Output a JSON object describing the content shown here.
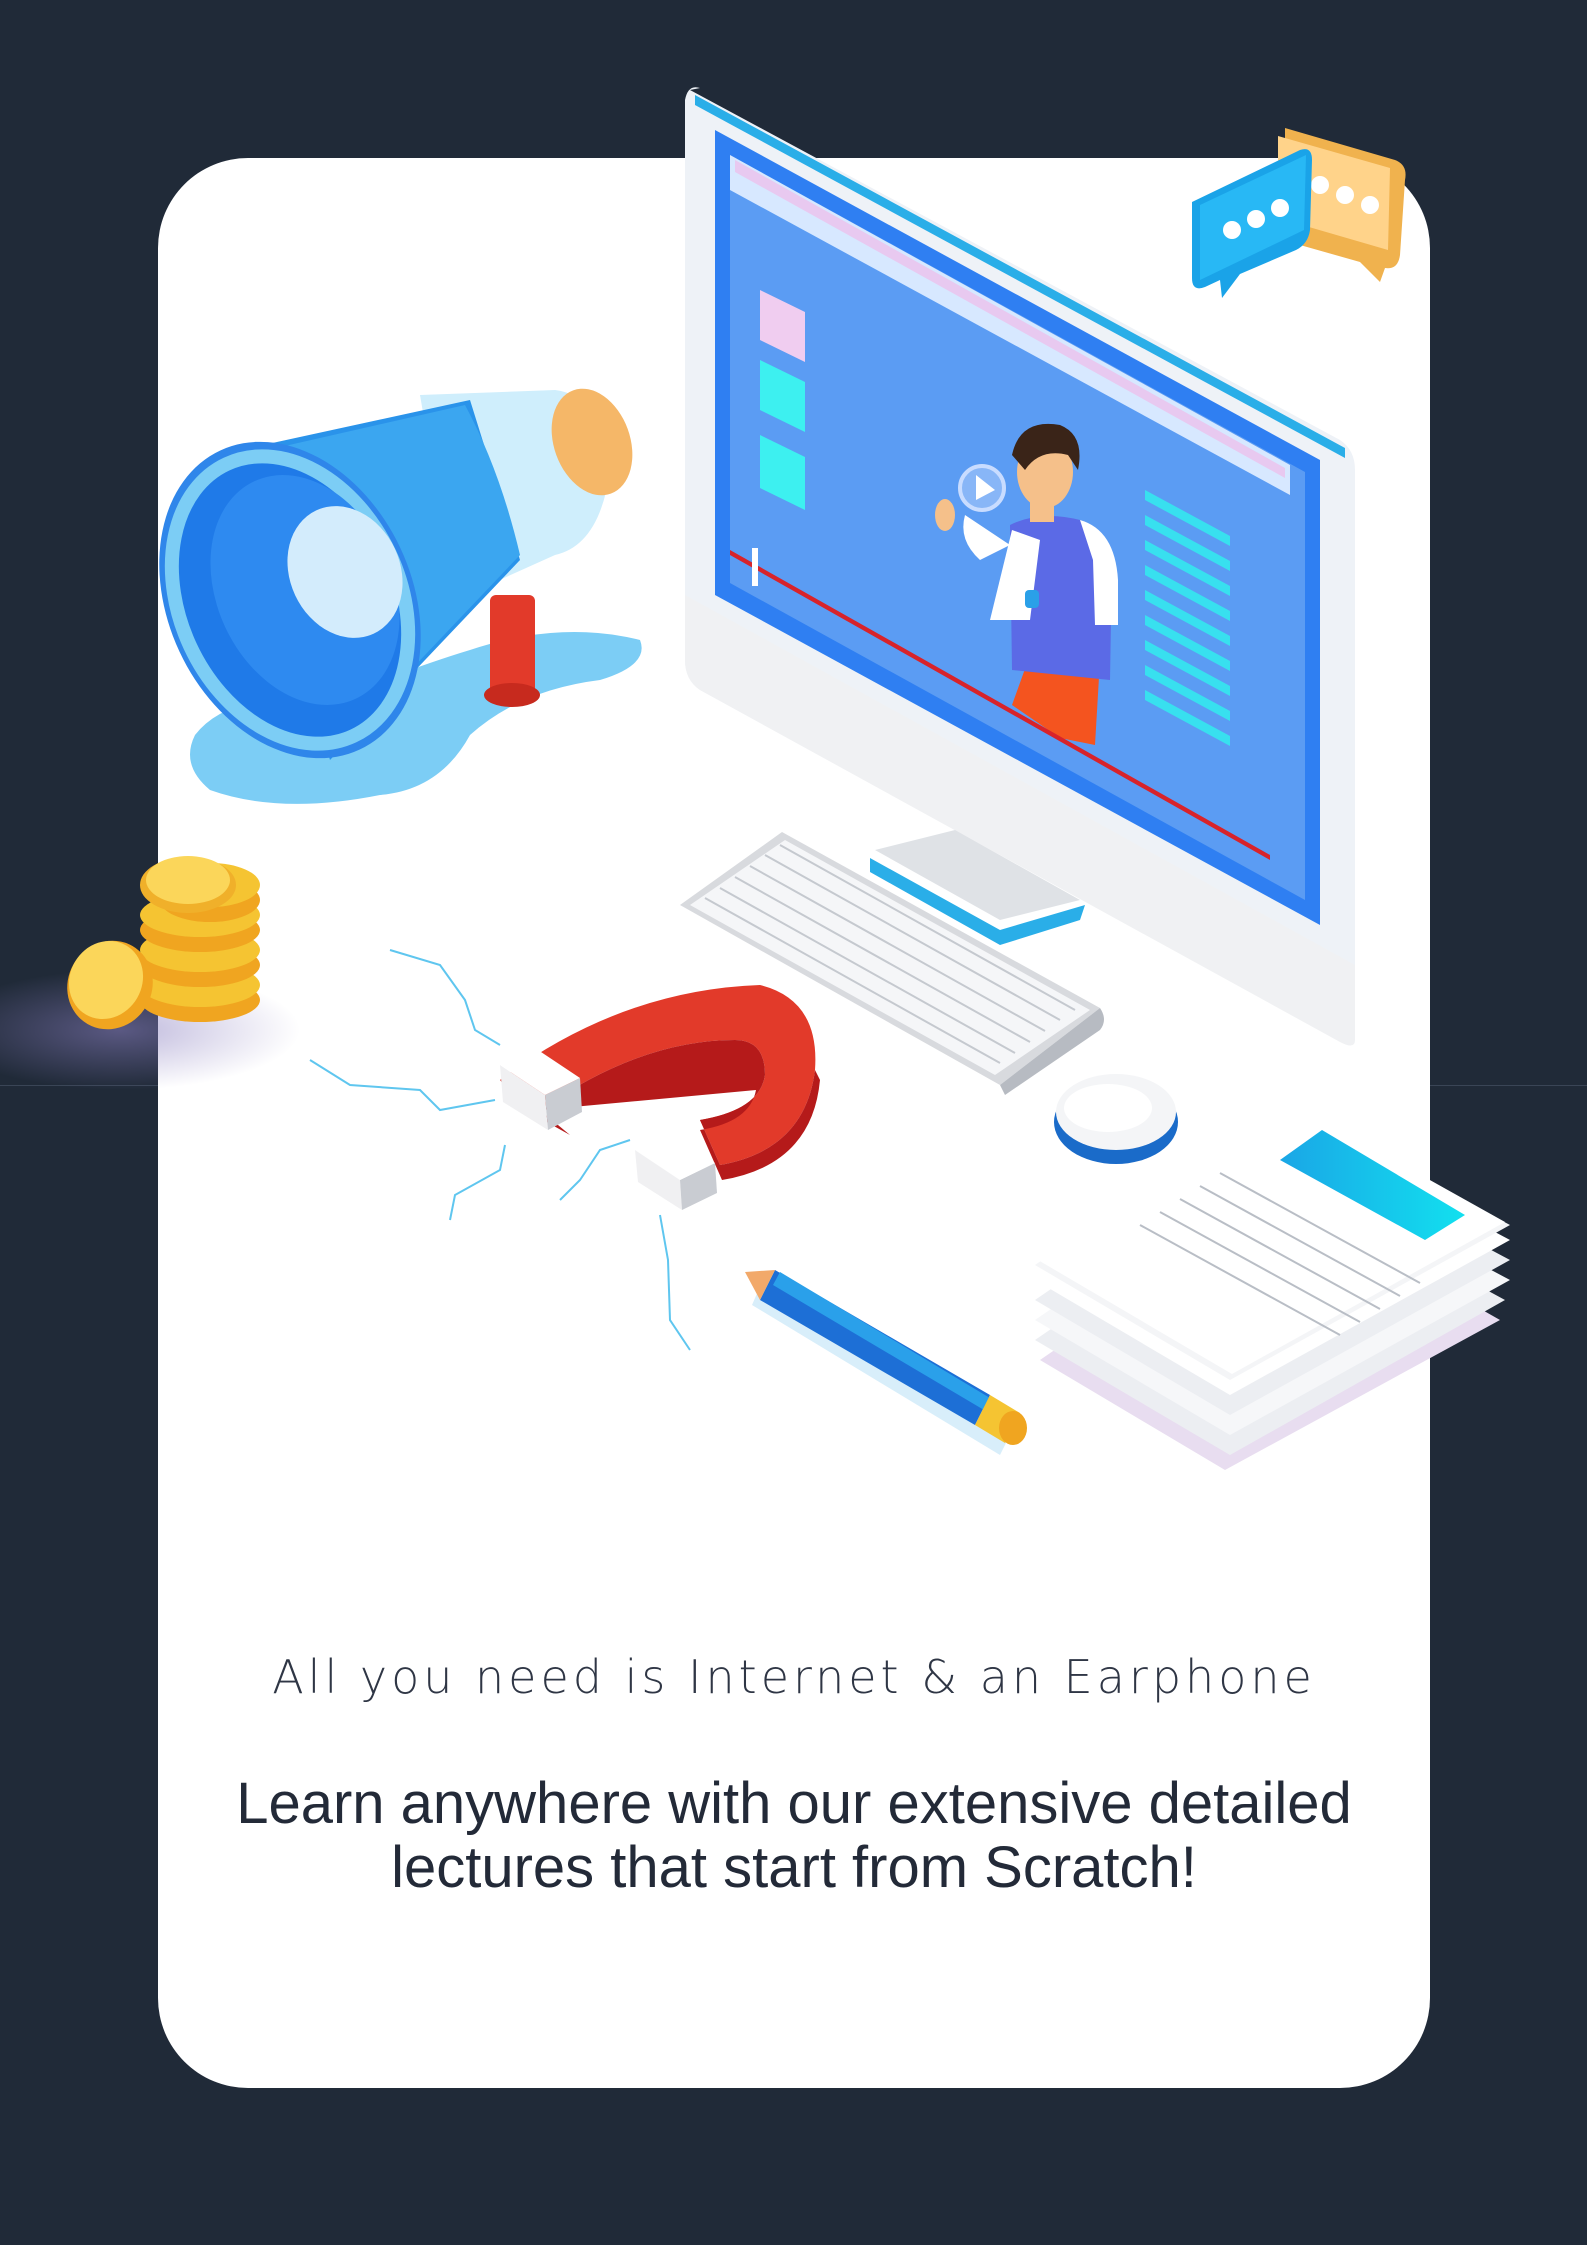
{
  "colors": {
    "background": "#202a38",
    "card": "#ffffff",
    "text": "#232a38",
    "screen_blue": "#2f7ff2",
    "accent_red": "#e23a2a",
    "coin_gold": "#f5c432"
  },
  "illustration": {
    "icons": [
      "megaphone-icon",
      "monitor-icon",
      "chat-bubbles-icon",
      "coins-icon",
      "magnet-icon",
      "keyboard-icon",
      "mouse-icon",
      "papers-icon",
      "pencil-icon"
    ]
  },
  "content": {
    "subtitle": "All you need is Internet & an Earphone",
    "headline_line1": "Learn anywhere with our extensive detailed",
    "headline_line2": "lectures that start from Scratch!"
  }
}
